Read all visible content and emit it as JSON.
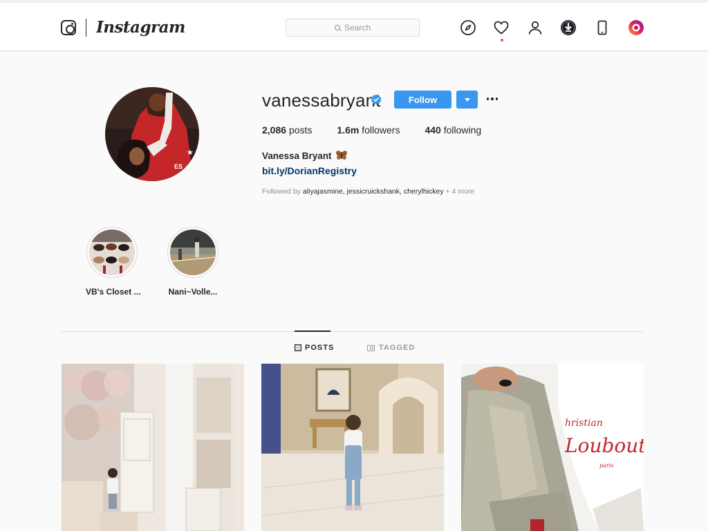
{
  "app": {
    "name": "Instagram"
  },
  "header": {
    "wordmark": "Instagram",
    "search": {
      "placeholder": "Search"
    },
    "nav_icons": [
      "compass-icon",
      "heart-icon",
      "profile-icon",
      "download-icon",
      "phone-icon",
      "extension-icon"
    ]
  },
  "profile": {
    "username": "vanessabryant",
    "verified": true,
    "follow_label": "Follow",
    "stats": {
      "posts_count": "2,086",
      "posts_label": "posts",
      "followers_count": "1.6m",
      "followers_label": "followers",
      "following_count": "440",
      "following_label": "following"
    },
    "full_name": "Vanessa Bryant",
    "bio_link": "bit.ly/DorianRegistry",
    "followed_by": {
      "prefix": "Followed by",
      "names": "aliyajasmine, jessicruickshank, cherylhickey",
      "suffix": "+ 4 more"
    }
  },
  "highlights": [
    {
      "label": "VB's Closet ..."
    },
    {
      "label": "Nani~Volle..."
    }
  ],
  "tabs": [
    {
      "label": "POSTS",
      "active": true
    },
    {
      "label": "TAGGED",
      "active": false
    }
  ],
  "colors": {
    "accent": "#3897f0",
    "link": "#003569",
    "text": "#262626",
    "muted": "#8e8e8e",
    "background": "#fafafa"
  }
}
